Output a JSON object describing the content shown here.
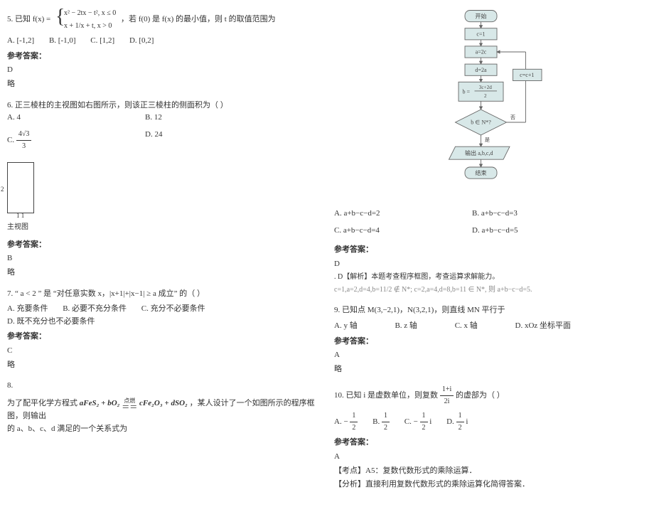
{
  "left": {
    "q5": {
      "prefix": "5. 已知 ",
      "fx": "f(x) =",
      "piece1": "x² − 2tx − t², x ≤ 0",
      "piece2": "x + 1/x + t, x > 0",
      "tail": "，若 f(0) 是 f(x) 的最小值，则 t 的取值范围为",
      "choices": {
        "A": "A. [-1,2]",
        "B": "B. [-1,0]",
        "C": "C. [1,2]",
        "D": "D. [0,2]"
      },
      "ansLabel": "参考答案：",
      "ans": "D",
      "omit": "略"
    },
    "q6": {
      "line": "6. 正三棱柱的主视图如右图所示，则该正三棱柱的侧面积为（  ）",
      "choices": {
        "A": "A.  4",
        "B": "B.  12",
        "C_pre": "C.  ",
        "C_frac_num": "4√3",
        "C_frac_den": "3",
        "D": "D.  24"
      },
      "viewSideLeft": "2",
      "viewSideBottom": "1  1",
      "caption": "主视图",
      "ansLabel": "参考答案：",
      "ans": "B",
      "omit": "略"
    },
    "q7": {
      "line": "7. “ a < 2 ” 是 “对任意实数 x，|x+1|+|x−1| ≥ a 成立” 的（     ）",
      "choices": {
        "A": "A. 充要条件",
        "B": "B. 必要不充分条件",
        "C": "C. 充分不必要条件",
        "D": "D. 既不充分也不必要条件"
      },
      "ansLabel": "参考答案：",
      "ans": "C",
      "omit": "略"
    },
    "q8": {
      "num": "8.",
      "line1_pre": "为了配平化学方程式 ",
      "eq_left": "aFeS₂ + bO₂",
      "eq_top": "点燃",
      "eq_eq": "＝＝",
      "eq_right": "cFe₂O₃ + dSO₂",
      "line1_post": "，某人设计了一个如图所示的程序框图，则输出",
      "line2": "的 a、b、c、d 满足的一个关系式为"
    }
  },
  "right": {
    "flow": {
      "start": "开始",
      "b1": "c=1",
      "b2": "a=2c",
      "b3": "d=2a",
      "b4_lhs": "b = ",
      "b4_num": "3c+2d",
      "b4_den": "2",
      "diamond": "b ∈ N*?",
      "yes": "是",
      "no": "否",
      "loop": "c=c+1",
      "out": "输出 a,b,c,d",
      "end": "结束"
    },
    "q8choices": {
      "A": "A. a+b−c−d=2",
      "B": "B. a+b−c−d=3",
      "C": "C. a+b−c−d=4",
      "D": "D. a+b−c−d=5"
    },
    "q8ansLabel": "参考答案：",
    "q8ans": "D",
    "q8expl1": ". D【解析】本题考查程序框图，考查运算求解能力。",
    "q8expl2": "c=1,a=2,d=4,b=11/2 ∉ N*; c=2,a=4,d=8,b=11 ∈ N*, 则 a+b−c−d=5.",
    "q9": {
      "line": "9. 已知点 M(3,−2,1)，N(3,2,1)，则直线 MN 平行于",
      "choices": {
        "A": "A. y 轴",
        "B": "B. z 轴",
        "C": "C. x 轴",
        "D": "D. xOz 坐标平面"
      },
      "ansLabel": "参考答案：",
      "ans": "A",
      "omit": "略"
    },
    "q10": {
      "pre": "10. 已知 i 是虚数单位，则复数 ",
      "frac_num": "1+i",
      "frac_den": "2i",
      "post": " 的虚部为（     ）",
      "choices": {
        "A_pre": "A.  − ",
        "A_num": "1",
        "A_den": "2",
        "B_pre": "B.    ",
        "B_num": "1",
        "B_den": "2",
        "C_pre": "C.  − ",
        "C_num": "1",
        "C_den": "2",
        "C_suf": "  i",
        "D_pre": "D.    ",
        "D_num": "1",
        "D_den": "2",
        "D_suf": "  i"
      },
      "ansLabel": "参考答案：",
      "ans": "A",
      "k1": "【考点】A5：复数代数形式的乘除运算．",
      "k2": "【分析】直接利用复数代数形式的乘除运算化简得答案．"
    }
  }
}
